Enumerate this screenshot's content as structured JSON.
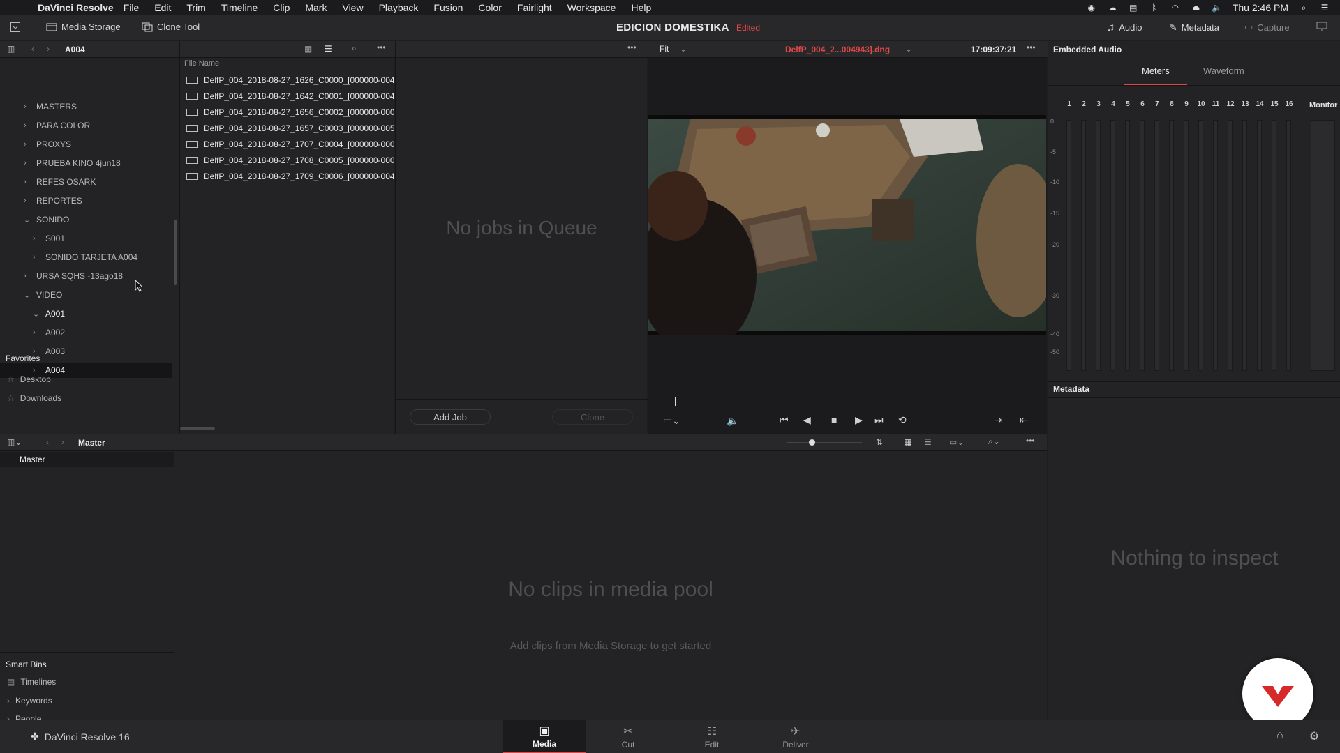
{
  "menubar": {
    "app_name": "DaVinci Resolve",
    "menus": [
      "File",
      "Edit",
      "Trim",
      "Timeline",
      "Clip",
      "Mark",
      "View",
      "Playback",
      "Fusion",
      "Color",
      "Fairlight",
      "Workspace",
      "Help"
    ],
    "clock": "Thu 2:46 PM"
  },
  "toolbar": {
    "media_storage": "Media Storage",
    "clone_tool": "Clone Tool",
    "project_title": "EDICION DOMESTIKA",
    "project_status": "Edited",
    "audio": "Audio",
    "metadata": "Metadata",
    "capture": "Capture"
  },
  "storage": {
    "current_folder": "A004",
    "tree": [
      {
        "label": "MASTERS",
        "indent": 0,
        "expanded": false
      },
      {
        "label": "PARA COLOR",
        "indent": 0,
        "expanded": false
      },
      {
        "label": "PROXYS",
        "indent": 0,
        "expanded": false
      },
      {
        "label": "PRUEBA KINO 4jun18",
        "indent": 0,
        "expanded": false
      },
      {
        "label": "REFES OSARK",
        "indent": 0,
        "expanded": false
      },
      {
        "label": "REPORTES",
        "indent": 0,
        "expanded": false
      },
      {
        "label": "SONIDO",
        "indent": 0,
        "expanded": true
      },
      {
        "label": "S001",
        "indent": 1,
        "expanded": false
      },
      {
        "label": "SONIDO TARJETA A004",
        "indent": 1,
        "expanded": false
      },
      {
        "label": "URSA SQHS -13ago18",
        "indent": 0,
        "expanded": false
      },
      {
        "label": "VIDEO",
        "indent": 0,
        "expanded": true
      },
      {
        "label": "A001",
        "indent": 1,
        "expanded": true
      },
      {
        "label": "A002",
        "indent": 1,
        "expanded": false
      },
      {
        "label": "A003",
        "indent": 1,
        "expanded": false
      },
      {
        "label": "A004",
        "indent": 1,
        "expanded": false,
        "selected": true
      }
    ],
    "favorites_title": "Favorites",
    "favorites": [
      "Desktop",
      "Downloads"
    ],
    "file_column": "File Name",
    "files": [
      "DelfP_004_2018-08-27_1626_C0000_[000000-004",
      "DelfP_004_2018-08-27_1642_C0001_[000000-004",
      "DelfP_004_2018-08-27_1656_C0002_[000000-000",
      "DelfP_004_2018-08-27_1657_C0003_[000000-005",
      "DelfP_004_2018-08-27_1707_C0004_[000000-000",
      "DelfP_004_2018-08-27_1708_C0005_[000000-000",
      "DelfP_004_2018-08-27_1709_C0006_[000000-004"
    ]
  },
  "queue": {
    "empty_text": "No jobs in Queue",
    "add_job": "Add Job",
    "clone": "Clone"
  },
  "viewer": {
    "zoom": "Fit",
    "clip_name": "DelfP_004_2...004943].dng",
    "timecode": "17:09:37:21"
  },
  "audio_panel": {
    "title": "Embedded Audio",
    "tab_meters": "Meters",
    "tab_waveform": "Waveform",
    "channels": [
      "1",
      "2",
      "3",
      "4",
      "5",
      "6",
      "7",
      "8",
      "9",
      "10",
      "11",
      "12",
      "13",
      "14",
      "15",
      "16"
    ],
    "monitor": "Monitor",
    "db_scale": [
      "0",
      "-5",
      "-10",
      "-15",
      "-20",
      "-30",
      "-40",
      "-50"
    ]
  },
  "metadata_panel": {
    "title": "Metadata",
    "empty_text": "Nothing to inspect"
  },
  "media_pool": {
    "bin": "Master",
    "bins": [
      "Master"
    ],
    "empty_title": "No clips in media pool",
    "empty_hint": "Add clips from Media Storage to get started",
    "smart_bins_title": "Smart Bins",
    "smart_bins": [
      "Timelines",
      "Keywords",
      "People"
    ]
  },
  "pagebar": {
    "version": "DaVinci Resolve 16",
    "pages": [
      "Media",
      "Cut",
      "Edit",
      "Deliver"
    ],
    "active": "Media"
  },
  "colors": {
    "accent_red": "#e04848",
    "panel": "#232326",
    "header": "#28282b"
  }
}
